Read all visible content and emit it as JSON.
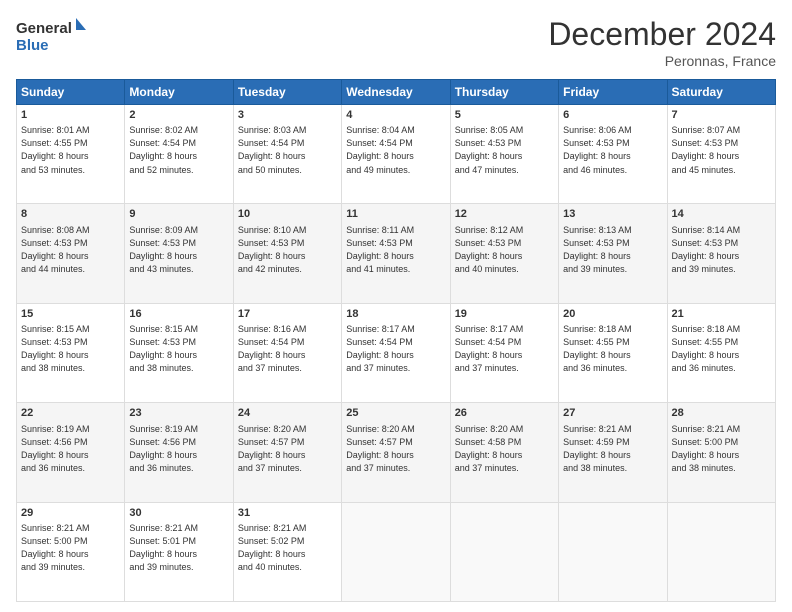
{
  "header": {
    "logo_line1": "General",
    "logo_line2": "Blue",
    "title": "December 2024",
    "subtitle": "Peronnas, France"
  },
  "weekdays": [
    "Sunday",
    "Monday",
    "Tuesday",
    "Wednesday",
    "Thursday",
    "Friday",
    "Saturday"
  ],
  "weeks": [
    [
      {
        "day": "1",
        "info": "Sunrise: 8:01 AM\nSunset: 4:55 PM\nDaylight: 8 hours\nand 53 minutes."
      },
      {
        "day": "2",
        "info": "Sunrise: 8:02 AM\nSunset: 4:54 PM\nDaylight: 8 hours\nand 52 minutes."
      },
      {
        "day": "3",
        "info": "Sunrise: 8:03 AM\nSunset: 4:54 PM\nDaylight: 8 hours\nand 50 minutes."
      },
      {
        "day": "4",
        "info": "Sunrise: 8:04 AM\nSunset: 4:54 PM\nDaylight: 8 hours\nand 49 minutes."
      },
      {
        "day": "5",
        "info": "Sunrise: 8:05 AM\nSunset: 4:53 PM\nDaylight: 8 hours\nand 47 minutes."
      },
      {
        "day": "6",
        "info": "Sunrise: 8:06 AM\nSunset: 4:53 PM\nDaylight: 8 hours\nand 46 minutes."
      },
      {
        "day": "7",
        "info": "Sunrise: 8:07 AM\nSunset: 4:53 PM\nDaylight: 8 hours\nand 45 minutes."
      }
    ],
    [
      {
        "day": "8",
        "info": "Sunrise: 8:08 AM\nSunset: 4:53 PM\nDaylight: 8 hours\nand 44 minutes."
      },
      {
        "day": "9",
        "info": "Sunrise: 8:09 AM\nSunset: 4:53 PM\nDaylight: 8 hours\nand 43 minutes."
      },
      {
        "day": "10",
        "info": "Sunrise: 8:10 AM\nSunset: 4:53 PM\nDaylight: 8 hours\nand 42 minutes."
      },
      {
        "day": "11",
        "info": "Sunrise: 8:11 AM\nSunset: 4:53 PM\nDaylight: 8 hours\nand 41 minutes."
      },
      {
        "day": "12",
        "info": "Sunrise: 8:12 AM\nSunset: 4:53 PM\nDaylight: 8 hours\nand 40 minutes."
      },
      {
        "day": "13",
        "info": "Sunrise: 8:13 AM\nSunset: 4:53 PM\nDaylight: 8 hours\nand 39 minutes."
      },
      {
        "day": "14",
        "info": "Sunrise: 8:14 AM\nSunset: 4:53 PM\nDaylight: 8 hours\nand 39 minutes."
      }
    ],
    [
      {
        "day": "15",
        "info": "Sunrise: 8:15 AM\nSunset: 4:53 PM\nDaylight: 8 hours\nand 38 minutes."
      },
      {
        "day": "16",
        "info": "Sunrise: 8:15 AM\nSunset: 4:53 PM\nDaylight: 8 hours\nand 38 minutes."
      },
      {
        "day": "17",
        "info": "Sunrise: 8:16 AM\nSunset: 4:54 PM\nDaylight: 8 hours\nand 37 minutes."
      },
      {
        "day": "18",
        "info": "Sunrise: 8:17 AM\nSunset: 4:54 PM\nDaylight: 8 hours\nand 37 minutes."
      },
      {
        "day": "19",
        "info": "Sunrise: 8:17 AM\nSunset: 4:54 PM\nDaylight: 8 hours\nand 37 minutes."
      },
      {
        "day": "20",
        "info": "Sunrise: 8:18 AM\nSunset: 4:55 PM\nDaylight: 8 hours\nand 36 minutes."
      },
      {
        "day": "21",
        "info": "Sunrise: 8:18 AM\nSunset: 4:55 PM\nDaylight: 8 hours\nand 36 minutes."
      }
    ],
    [
      {
        "day": "22",
        "info": "Sunrise: 8:19 AM\nSunset: 4:56 PM\nDaylight: 8 hours\nand 36 minutes."
      },
      {
        "day": "23",
        "info": "Sunrise: 8:19 AM\nSunset: 4:56 PM\nDaylight: 8 hours\nand 36 minutes."
      },
      {
        "day": "24",
        "info": "Sunrise: 8:20 AM\nSunset: 4:57 PM\nDaylight: 8 hours\nand 37 minutes."
      },
      {
        "day": "25",
        "info": "Sunrise: 8:20 AM\nSunset: 4:57 PM\nDaylight: 8 hours\nand 37 minutes."
      },
      {
        "day": "26",
        "info": "Sunrise: 8:20 AM\nSunset: 4:58 PM\nDaylight: 8 hours\nand 37 minutes."
      },
      {
        "day": "27",
        "info": "Sunrise: 8:21 AM\nSunset: 4:59 PM\nDaylight: 8 hours\nand 38 minutes."
      },
      {
        "day": "28",
        "info": "Sunrise: 8:21 AM\nSunset: 5:00 PM\nDaylight: 8 hours\nand 38 minutes."
      }
    ],
    [
      {
        "day": "29",
        "info": "Sunrise: 8:21 AM\nSunset: 5:00 PM\nDaylight: 8 hours\nand 39 minutes."
      },
      {
        "day": "30",
        "info": "Sunrise: 8:21 AM\nSunset: 5:01 PM\nDaylight: 8 hours\nand 39 minutes."
      },
      {
        "day": "31",
        "info": "Sunrise: 8:21 AM\nSunset: 5:02 PM\nDaylight: 8 hours\nand 40 minutes."
      },
      null,
      null,
      null,
      null
    ]
  ]
}
